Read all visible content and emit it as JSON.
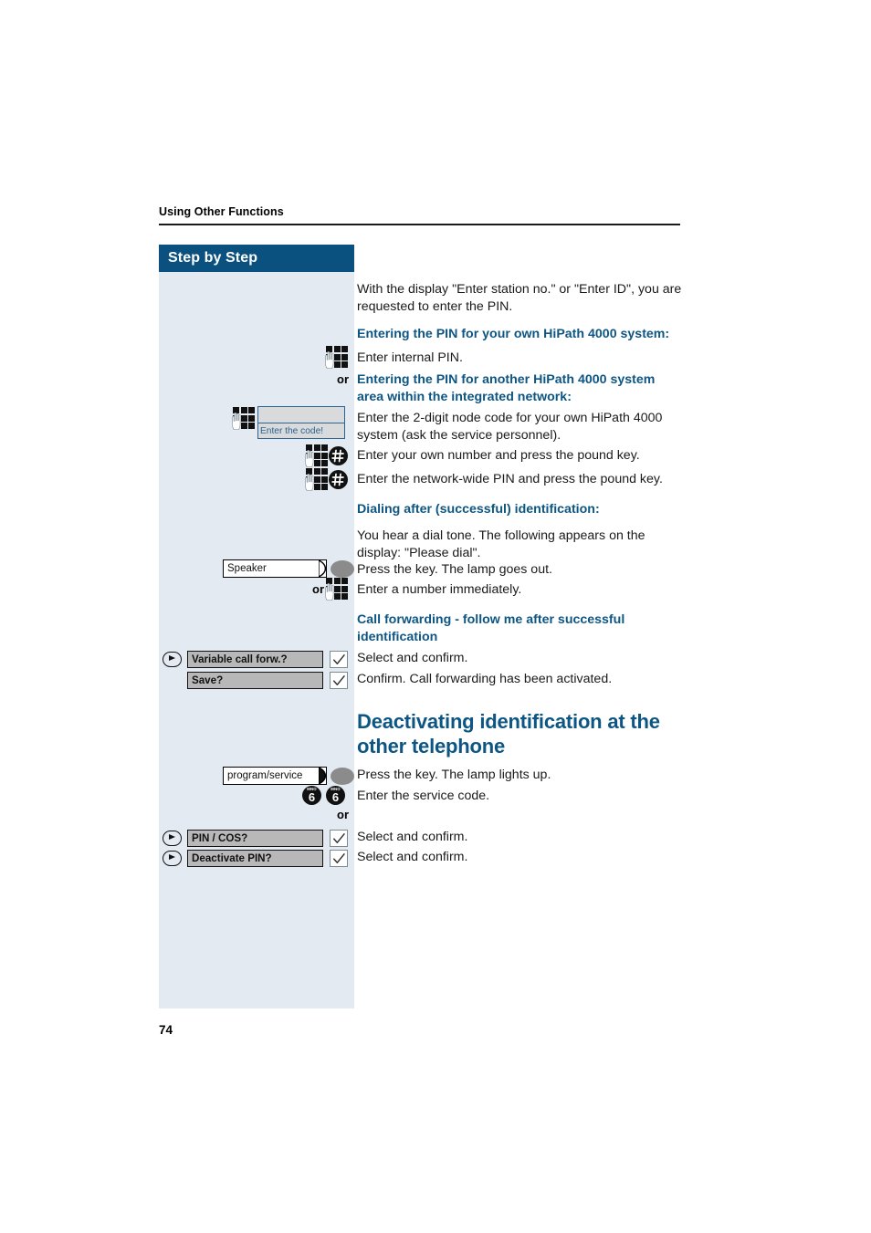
{
  "page": {
    "running_header": "Using Other Functions",
    "folio": "74",
    "sidebar_title": "Step by Step",
    "colors": {
      "brand_blue": "#0d5582",
      "header_bar_blue": "#0b5180",
      "sidebar_bg": "#e3eaf2",
      "option_bar_gray": "#b8b8b8",
      "lamp_gray": "#8b8b8b",
      "display_border_blue": "#2b6391",
      "display_bg": "#d9dadb"
    }
  },
  "content": {
    "intro_paragraph": "With the display \"Enter station no.\" or \"Enter ID\", you are requested to enter the PIN.",
    "heading_own_system": "Entering the PIN for your own HiPath 4000 system:",
    "step_enter_internal_pin": "Enter internal PIN.",
    "or_1": "or",
    "heading_other_system": "Entering the PIN for another HiPath 4000 system area within the integrated network:",
    "step_node_code": "Enter the 2-digit node code for your own HiPath 4000 system (ask the service personnel).",
    "display_enter_code": "Enter the code!",
    "step_own_number_pound": "Enter your own number and press the pound key.",
    "step_network_pin_pound": "Enter the network-wide PIN and press the pound key.",
    "heading_dialing": "Dialing after (successful) identification:",
    "paragraph_dial_tone": "You hear a dial tone. The following appears on the display: \"Please dial\".",
    "key_speaker": "Speaker",
    "step_press_key_lamp_out": "Press the key. The lamp goes out.",
    "or_2": "or",
    "step_enter_number": "Enter a number immediately.",
    "heading_call_forwarding": "Call forwarding - follow me after successful identification",
    "option_variable_call_forw": "Variable call forw.?",
    "step_select_confirm_1": "Select and confirm.",
    "option_save": "Save?",
    "step_confirm_activated": "Confirm. Call forwarding has been activated.",
    "heading_deactivating": "Deactivating identification at the other telephone",
    "key_program_service": "program/service",
    "step_press_key_lamp_up": "Press the key. The lamp lights up.",
    "service_code_digit_1": "6",
    "service_code_digit_1_letters": "MNO",
    "service_code_digit_2": "6",
    "service_code_digit_2_letters": "MNO",
    "step_enter_service_code": "Enter the service code.",
    "or_3": "or",
    "option_pin_cos": "PIN / COS?",
    "step_select_confirm_2": "Select and confirm.",
    "option_deactivate_pin": "Deactivate PIN?",
    "step_select_confirm_3": "Select and confirm."
  }
}
